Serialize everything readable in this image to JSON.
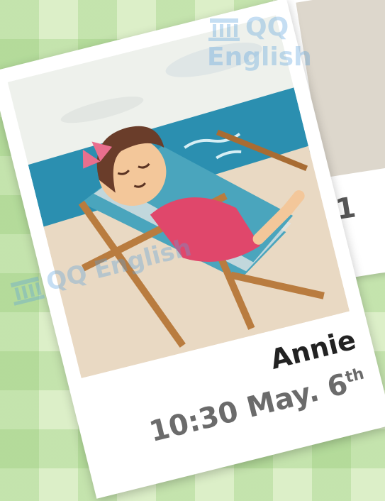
{
  "card": {
    "name": "Annie",
    "time": "10:30",
    "date": "May. 6",
    "date_suffix": "th"
  },
  "side_card": {
    "caption_partial": "1"
  },
  "watermark": {
    "text": "QQ English",
    "icon": "library-building-icon"
  },
  "colors": {
    "sky": "#e8efe9",
    "sea": "#2b8fb0",
    "sand": "#e9d9c3",
    "dress": "#e0476b",
    "bow": "#e96f8e",
    "hair": "#6a3d2a",
    "chair_wood": "#b97c3f",
    "chair_fabric": "#4aa5bd"
  }
}
